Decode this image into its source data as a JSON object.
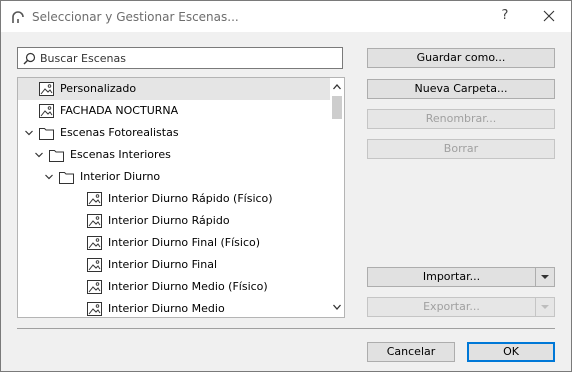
{
  "window": {
    "title": "Seleccionar y Gestionar Escenas...",
    "help": "?"
  },
  "search": {
    "placeholder": "Buscar Escenas"
  },
  "tree": {
    "items": [
      {
        "label": "Personalizado",
        "type": "scene",
        "level": 0,
        "selected": true
      },
      {
        "label": "FACHADA NOCTURNA",
        "type": "scene",
        "level": 0
      },
      {
        "label": "Escenas Fotorealistas",
        "type": "folder",
        "level": 0,
        "expanded": true
      },
      {
        "label": "Escenas Interiores",
        "type": "folder",
        "level": 1,
        "expanded": true
      },
      {
        "label": "Interior Diurno",
        "type": "folder",
        "level": 2,
        "expanded": true
      },
      {
        "label": "Interior Diurno Rápido (Físico)",
        "type": "scene",
        "level": 3
      },
      {
        "label": "Interior Diurno Rápido",
        "type": "scene",
        "level": 3
      },
      {
        "label": "Interior Diurno Final (Físico)",
        "type": "scene",
        "level": 3
      },
      {
        "label": "Interior Diurno Final",
        "type": "scene",
        "level": 3
      },
      {
        "label": "Interior Diurno Medio (Físico)",
        "type": "scene",
        "level": 3
      },
      {
        "label": "Interior Diurno Medio",
        "type": "scene",
        "level": 3
      }
    ]
  },
  "buttons": {
    "save_as": "Guardar como...",
    "new_folder": "Nueva Carpeta...",
    "rename": "Renombrar...",
    "delete": "Borrar",
    "import": "Importar...",
    "export": "Exportar...",
    "cancel": "Cancelar",
    "ok": "OK"
  },
  "colors": {
    "accent": "#0078d7",
    "selection": "#e5e5e5",
    "disabled_text": "#a0a0a0"
  }
}
